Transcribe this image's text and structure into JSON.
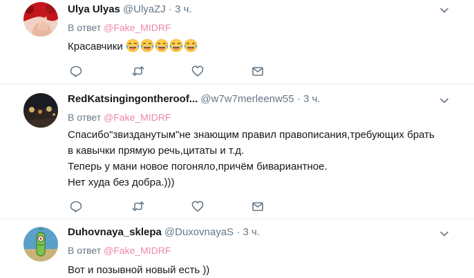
{
  "tweets": [
    {
      "name": "Ulya Ulyas",
      "handle": "@UlyaZJ",
      "separator": "·",
      "time": "3 ч.",
      "reply_prefix": "В ответ",
      "reply_to": "@Fake_MIDRF",
      "text": "Красавчики",
      "emoji": [
        "face-with-tears-of-joy",
        "face-with-tears-of-joy",
        "face-with-tears-of-joy",
        "face-with-tears-of-joy",
        "face-with-tears-of-joy"
      ]
    },
    {
      "name": "RedKatsingingontheroof...",
      "handle": "@w7w7merleenw55",
      "separator": "·",
      "time": "3 ч.",
      "reply_prefix": "В ответ",
      "reply_to": "@Fake_MIDRF",
      "lines": [
        "Спасибо\"звизданутым\"не знающим правил правописания,требующих брать",
        "в кавычки прямую речь,цитаты и т.д.",
        "Теперь у мани новое погоняло,причём бивариантное.",
        "Нет худа без добра.)))"
      ]
    },
    {
      "name": "Duhovnaya_sklepa",
      "handle": "@DuxovnayaS",
      "separator": "·",
      "time": "3 ч.",
      "reply_prefix": "В ответ",
      "reply_to": "@Fake_MIDRF",
      "text": "Вот и позывной новый есть ))"
    }
  ],
  "icons": {
    "reply": "reply-icon",
    "retweet": "retweet-icon",
    "like": "heart-icon",
    "message": "envelope-icon",
    "menu": "chevron-down-icon"
  },
  "colors": {
    "mention": "#e0245e",
    "meta": "#657786",
    "text": "#14171a",
    "divider": "#e6ecf0"
  }
}
